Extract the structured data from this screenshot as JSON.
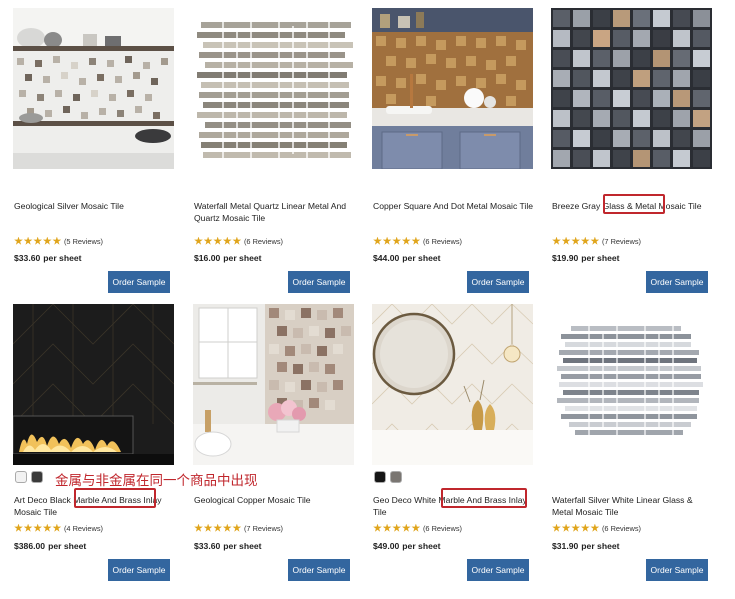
{
  "products": [
    {
      "title": "Geological Silver Mosaic Tile",
      "reviews": "(5 Reviews)",
      "price": "$33.60",
      "unit": "per sheet",
      "button": "Order Sample"
    },
    {
      "title": "Waterfall Metal Quartz Linear Metal And Quartz Mosaic Tile",
      "reviews": "(6 Reviews)",
      "price": "$16.00",
      "unit": "per sheet",
      "button": "Order Sample"
    },
    {
      "title": "Copper Square And Dot Metal Mosaic Tile",
      "reviews": "(6 Reviews)",
      "price": "$44.00",
      "unit": "per sheet",
      "button": "Order Sample"
    },
    {
      "title": "Breeze Gray Glass & Metal Mosaic Tile",
      "reviews": "(7 Reviews)",
      "price": "$19.90",
      "unit": "per sheet",
      "button": "Order Sample"
    },
    {
      "title": "Art Deco Black Marble And Brass Inlay Mosaic Tile",
      "reviews": "(4 Reviews)",
      "price": "$386.00",
      "unit": "per sheet",
      "button": "Order Sample"
    },
    {
      "title": "Geological Copper Mosaic Tile",
      "reviews": "(7 Reviews)",
      "price": "$33.60",
      "unit": "per sheet",
      "button": "Order Sample"
    },
    {
      "title": "Geo Deco White Marble And Brass Inlay Tile",
      "reviews": "(6 Reviews)",
      "price": "$49.00",
      "unit": "per sheet",
      "button": "Order Sample"
    },
    {
      "title": "Waterfall Silver White Linear Glass & Metal Mosaic Tile",
      "reviews": "(6 Reviews)",
      "price": "$31.90",
      "unit": "per sheet",
      "button": "Order Sample"
    }
  ],
  "annotation": "金属与非金属在同一个商品中出现",
  "colors": {
    "button": "#33669f",
    "star": "#e0a51c",
    "highlight": "#c0272d"
  }
}
